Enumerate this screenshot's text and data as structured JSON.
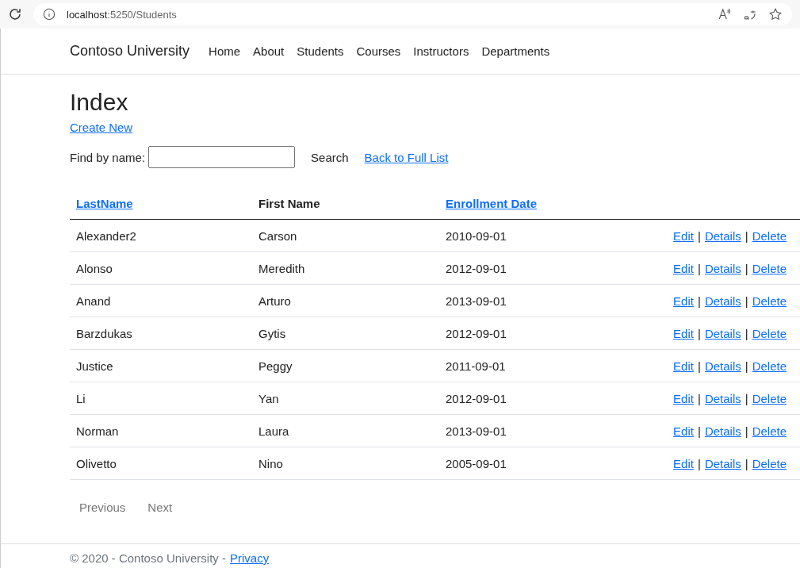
{
  "browser": {
    "url_host": "localhost",
    "url_path": ":5250/Students"
  },
  "navbar": {
    "brand": "Contoso University",
    "links": [
      "Home",
      "About",
      "Students",
      "Courses",
      "Instructors",
      "Departments"
    ]
  },
  "page": {
    "title": "Index",
    "create_link": "Create New"
  },
  "search": {
    "label": "Find by name:",
    "button": "Search",
    "back_link": "Back to Full List"
  },
  "table": {
    "columns": [
      {
        "label": "LastName",
        "sortable": true
      },
      {
        "label": "First Name",
        "sortable": false
      },
      {
        "label": "Enrollment Date",
        "sortable": true
      }
    ],
    "rows": [
      {
        "last": "Alexander2",
        "first": "Carson",
        "date": "2010-09-01",
        "actions": [
          "Edit",
          "|",
          "Details",
          "|",
          "Delete"
        ]
      },
      {
        "last": "Alonso",
        "first": "Meredith",
        "date": "2012-09-01",
        "actions": [
          "Edit",
          "|",
          "Details",
          "|",
          "Delete"
        ]
      },
      {
        "last": "Anand",
        "first": "Arturo",
        "date": "2013-09-01",
        "actions": [
          "Edit",
          "|",
          "Details",
          "|",
          "Delete"
        ]
      },
      {
        "last": "Barzdukas",
        "first": "Gytis",
        "date": "2012-09-01",
        "actions": [
          "Edit",
          "|",
          "Details",
          "|",
          "Delete"
        ]
      },
      {
        "last": "Justice",
        "first": "Peggy",
        "date": "2011-09-01",
        "actions": [
          "Edit",
          "|",
          "Details",
          "|",
          "Delete"
        ]
      },
      {
        "last": "Li",
        "first": "Yan",
        "date": "2012-09-01",
        "actions": [
          "Edit",
          "|",
          "Details",
          "|",
          "Delete"
        ]
      },
      {
        "last": "Norman",
        "first": "Laura",
        "date": "2013-09-01",
        "actions": [
          "Edit",
          "|",
          "Details",
          "|",
          "Delete"
        ]
      },
      {
        "last": "Olivetto",
        "first": "Nino",
        "date": "2005-09-01",
        "actions": [
          "Edit",
          "|",
          "Details",
          "|",
          "Delete"
        ]
      }
    ]
  },
  "pager": [
    {
      "label": "Previous",
      "disabled": true
    },
    {
      "label": "Next",
      "disabled": true
    }
  ],
  "footer": {
    "text": "© 2020 - Contoso University -",
    "link": "Privacy"
  }
}
